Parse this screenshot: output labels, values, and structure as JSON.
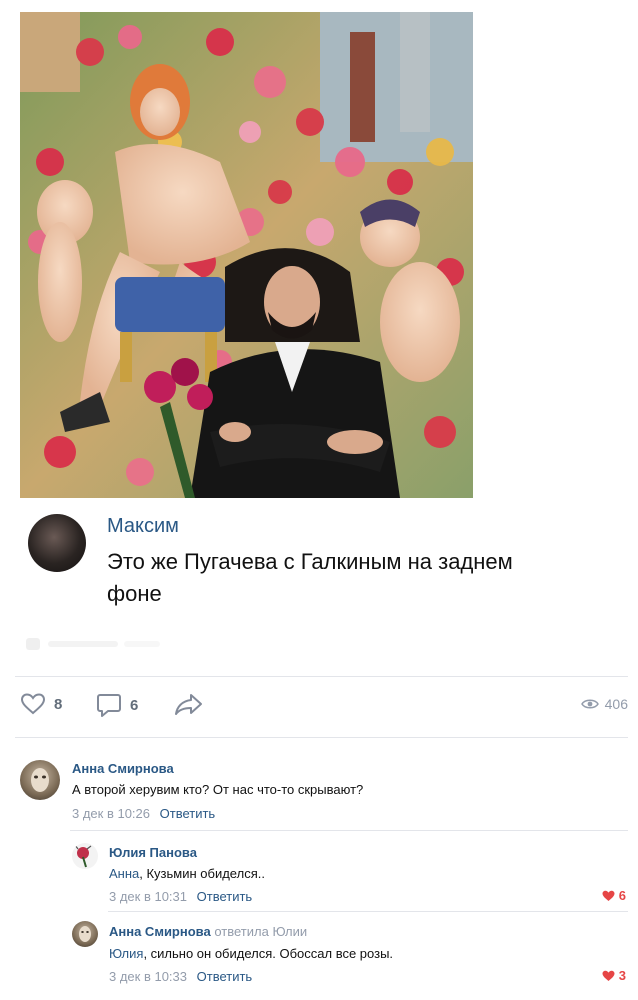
{
  "post": {
    "photo_icon": "photo-painting-portrait",
    "quote": {
      "author": "Максим",
      "text": "Это же Пугачева с Галкиным на заднем фоне"
    },
    "actions": {
      "likes": "8",
      "comments": "6",
      "views": "406"
    }
  },
  "comments": [
    {
      "author": "Анна Смирнова",
      "text": "А второй херувим кто? От нас что-то скрывают?",
      "date": "3 дек в 10:26",
      "reply_label": "Ответить"
    },
    {
      "author": "Юлия Панова",
      "mention": "Анна",
      "text": ", Кузьмин обиделся..",
      "date": "3 дек в 10:31",
      "reply_label": "Ответить",
      "likes": "6"
    },
    {
      "author": "Анна Смирнова",
      "reply_to": "ответила Юлии",
      "mention": "Юлия",
      "text": ", сильно он обиделся. Обоссал все розы.",
      "date": "3 дек в 10:33",
      "reply_label": "Ответить",
      "likes": "3"
    }
  ],
  "colors": {
    "link": "#2a5885",
    "meta": "#939cab",
    "like": "#e64646"
  }
}
